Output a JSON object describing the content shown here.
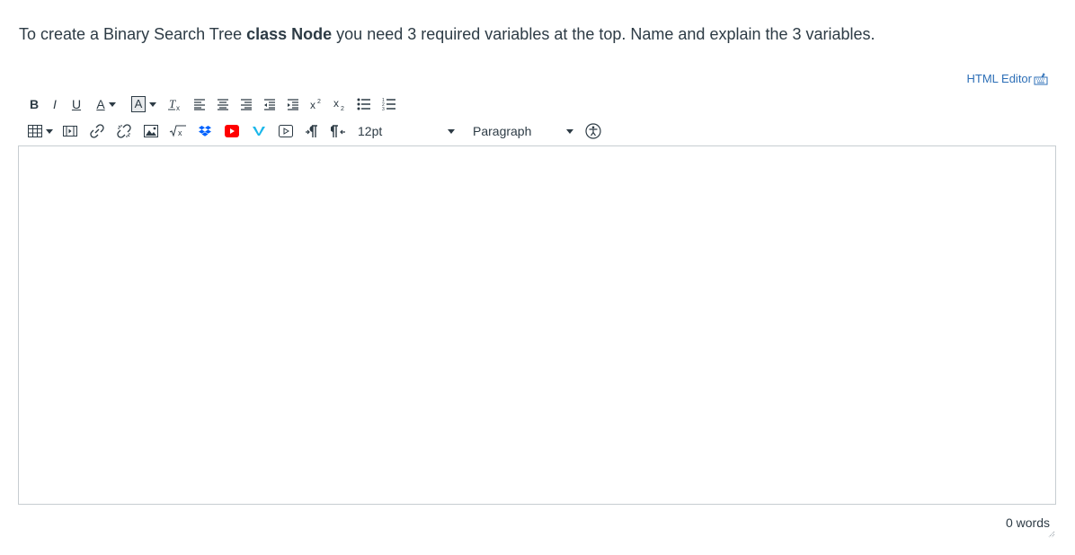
{
  "question": {
    "text_before": "To create a Binary Search Tree ",
    "bold": "class Node",
    "text_after": " you need 3 required variables at the top. Name and explain the 3 variables."
  },
  "editor": {
    "html_editor_label": "HTML Editor",
    "font_size": "12pt",
    "block_format": "Paragraph",
    "word_count": "0 words",
    "content": ""
  },
  "toolbar": {
    "bold": "B",
    "italic": "I",
    "underline": "U",
    "text_color": "A",
    "background_color": "A"
  },
  "colors": {
    "text": "#2d3b45",
    "link": "#2d6fb7",
    "border": "#c7cdd1",
    "youtube_red": "#ff0000",
    "dropbox_blue": "#0061fe",
    "vimeo_blue": "#1ab7ea"
  }
}
